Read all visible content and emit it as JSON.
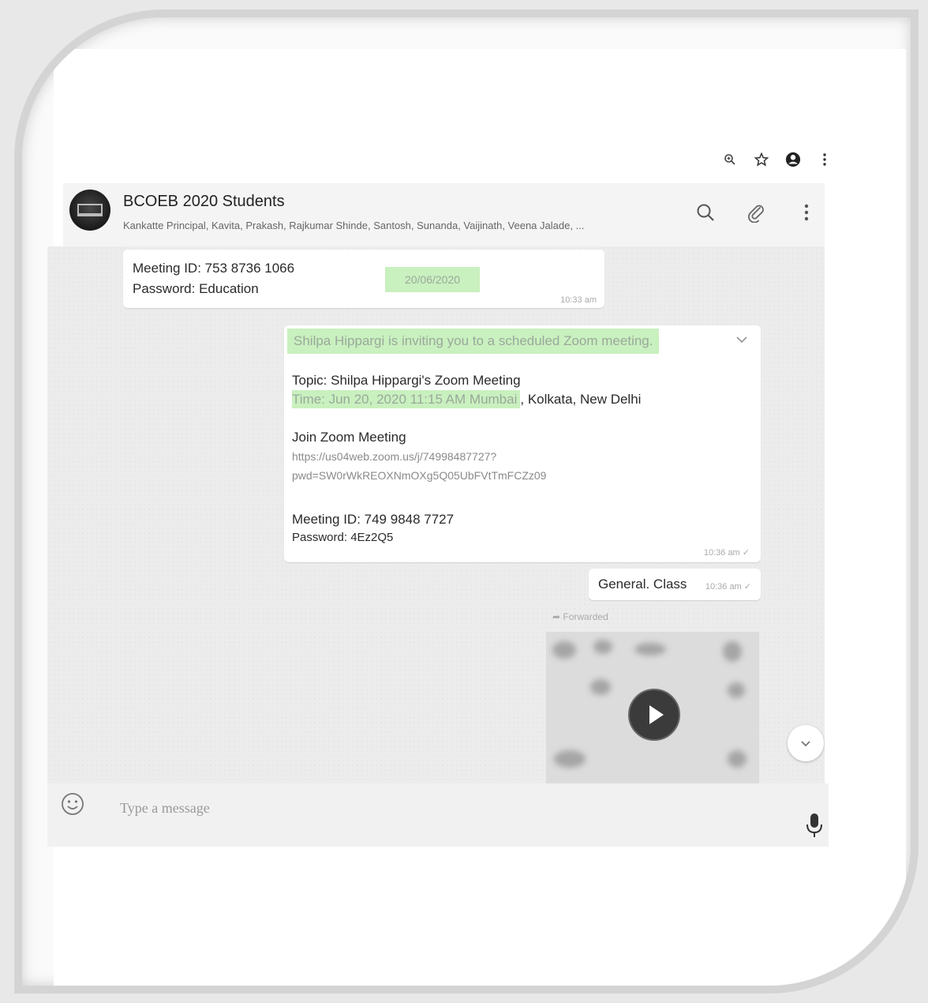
{
  "browser_toolbar": {
    "icons": [
      "zoom-icon",
      "star-icon",
      "account-icon",
      "more-vert-icon"
    ]
  },
  "chat": {
    "group_name": "BCOEB 2020 Students",
    "members": "Kankatte Principal, Kavita, Prakash, Rajkumar Shinde, Santosh, Sunanda, Vaijinath, Veena Jalade, ...",
    "header_icons": [
      "search-icon",
      "attach-icon",
      "menu-icon"
    ]
  },
  "messages": {
    "first": {
      "meeting_id": "Meeting ID: 753 8736 1066",
      "password": "Password: Education",
      "highlight_date": "20/06/2020",
      "time": "10:33 am"
    },
    "invite": {
      "invite_text": "Shilpa Hippargi is inviting you to a scheduled Zoom meeting.",
      "topic": "Topic: Shilpa Hippargi's Zoom Meeting",
      "time_highlight": "Time: Jun 20, 2020 11:15 AM Mumbai",
      "time_rest": ", Kolkata, New Delhi",
      "join": "Join Zoom Meeting",
      "link_line1": "https://us04web.zoom.us/j/74998487727?",
      "link_line2": "pwd=SW0rWkREOXNmOXg5Q05UbFVtTmFCZz09",
      "meeting_id": "Meeting ID: 749 9848 7727",
      "password": "Password: 4Ez2Q5",
      "time": "10:36 am ✓"
    },
    "general": {
      "text": "General. Class",
      "time": "10:36 am ✓"
    },
    "forwarded_label": "Forwarded"
  },
  "composer": {
    "placeholder": "Type a message"
  },
  "colors": {
    "highlight": "#c9f0bf",
    "chat_bg": "#ececec",
    "bubble": "#ffffff"
  }
}
